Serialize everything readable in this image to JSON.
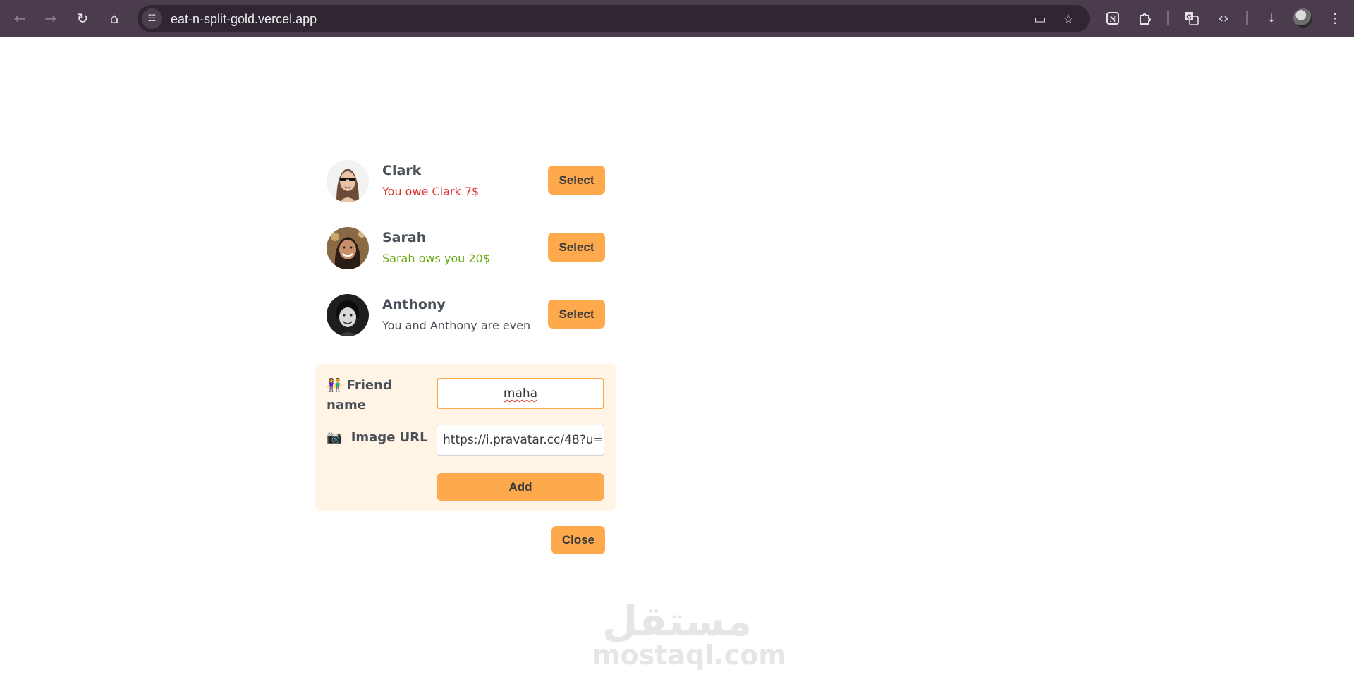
{
  "browser": {
    "url": "eat-n-split-gold.vercel.app",
    "icons": {
      "back": "arrow-left-icon",
      "forward": "arrow-right-icon",
      "reload": "reload-icon",
      "home": "home-icon",
      "site_info": "tune-icon",
      "install": "install-app-icon",
      "bookmark": "star-icon",
      "notion": "notion-icon",
      "extensions": "puzzle-icon",
      "translate": "translate-icon",
      "devtools": "code-icon",
      "download": "download-icon",
      "menu": "kebab-menu-icon"
    }
  },
  "friends": [
    {
      "name": "Clark",
      "status": "You owe Clark 7$",
      "status_kind": "owe",
      "select_label": "Select"
    },
    {
      "name": "Sarah",
      "status": "Sarah ows you 20$",
      "status_kind": "owed",
      "select_label": "Select"
    },
    {
      "name": "Anthony",
      "status": "You and Anthony are even",
      "status_kind": "even",
      "select_label": "Select"
    }
  ],
  "add_form": {
    "name_emoji": "👫",
    "name_label": "Friend name",
    "name_value": "maha",
    "image_emoji": "📷",
    "image_label": "Image URL",
    "image_value": "https://i.pravatar.cc/48?u=",
    "add_label": "Add"
  },
  "close_label": "Close",
  "watermark": {
    "arabic": "مستقل",
    "latin": "mostaql.com"
  },
  "colors": {
    "accent": "#ffa94d",
    "form_bg": "#fff4e6",
    "owe": "#e03131",
    "owed": "#66a80f",
    "text": "#495057",
    "chrome": "#4a3c4d"
  }
}
